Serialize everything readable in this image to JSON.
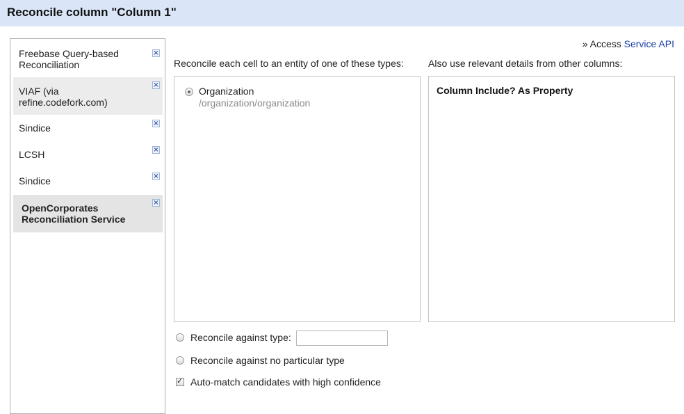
{
  "dialog": {
    "title": "Reconcile column \"Column 1\""
  },
  "services": [
    {
      "label": "Freebase Query-based Reconciliation"
    },
    {
      "label": "VIAF (via refine.codefork.com)"
    },
    {
      "label": "Sindice"
    },
    {
      "label": "LCSH"
    },
    {
      "label": "Sindice"
    },
    {
      "label": "OpenCorporates Reconciliation Service"
    }
  ],
  "access": {
    "prefix": "» Access",
    "link": "Service API"
  },
  "types_panel": {
    "heading": "Reconcile each cell to an entity of one of these types:",
    "types": [
      {
        "name": "Organization",
        "id": "/organization/organization",
        "selected": true
      }
    ]
  },
  "columns_panel": {
    "heading": "Also use relevant details from other columns:",
    "header": "Column Include? As Property"
  },
  "options": {
    "against_type_label": "Reconcile against type:",
    "against_type_value": "",
    "no_type_label": "Reconcile against no particular type",
    "auto_match_label": "Auto-match candidates with high confidence",
    "auto_match_checked": true
  },
  "colors": {
    "header_bg": "#dae6f8",
    "link": "#1a3ea8",
    "selected_item_bg": "#e4e4e4"
  }
}
